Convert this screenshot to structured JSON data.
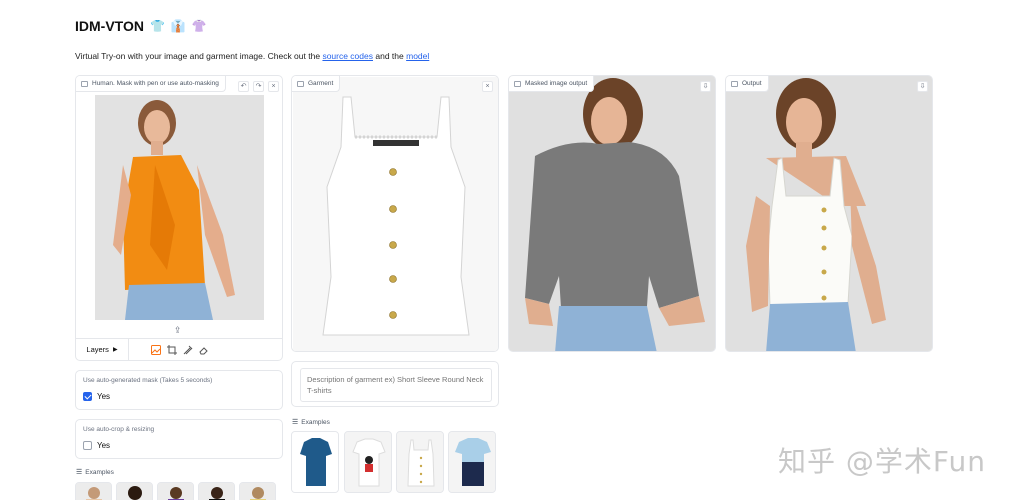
{
  "header": {
    "title": "IDM-VTON",
    "emojis": [
      "👕",
      "👔",
      "👚"
    ],
    "subtitle_pre": "Virtual Try-on with your image and garment image. Check out the",
    "link_source": "source codes",
    "subtitle_mid": "and the",
    "link_model": "model"
  },
  "human_panel": {
    "label": "Human. Mask with pen or use auto-masking",
    "undo": "↶",
    "redo": "↷",
    "close": "×",
    "upload": "⇪",
    "layers": "Layers"
  },
  "garment_panel": {
    "label": "Garment",
    "close": "×"
  },
  "masked_panel": {
    "label": "Masked image output",
    "download": "⇩"
  },
  "output_panel": {
    "label": "Output",
    "download": "⇩"
  },
  "auto_mask": {
    "label": "Use auto-generated mask (Takes 5 seconds)",
    "option": "Yes",
    "checked": true
  },
  "auto_crop": {
    "label": "Use auto-crop & resizing",
    "option": "Yes",
    "checked": false
  },
  "description": {
    "placeholder": "Description of garment ex) Short Sleeve Round Neck T-shirts"
  },
  "examples": {
    "label": "Examples"
  },
  "garment_examples": {
    "label": "Examples"
  },
  "watermark": "知乎 @学术Fun"
}
